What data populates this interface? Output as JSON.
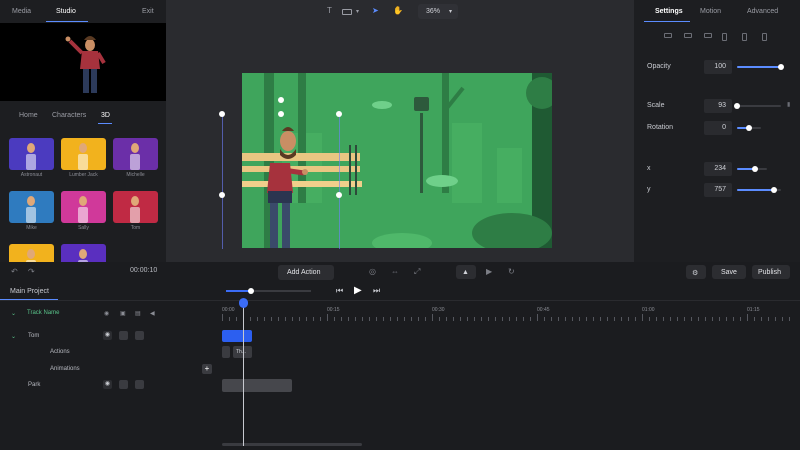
{
  "left_panel": {
    "tabs": [
      "Media",
      "Studio",
      "Exit"
    ],
    "active_tab": "Studio",
    "categories": [
      "Home",
      "Characters",
      "3D"
    ],
    "active_category": "3D",
    "characters": [
      {
        "name": "Astronaut",
        "bg": "#4b3bbf"
      },
      {
        "name": "Lumber Jack",
        "bg": "#f2b21d"
      },
      {
        "name": "Michelle",
        "bg": "#6b2fa8"
      },
      {
        "name": "Mike",
        "bg": "#2f7bbf"
      },
      {
        "name": "Sally",
        "bg": "#d0399a"
      },
      {
        "name": "Tom",
        "bg": "#c02a44"
      },
      {
        "name": "",
        "bg": "#f2b21d"
      },
      {
        "name": "",
        "bg": "#5a2fbf"
      }
    ]
  },
  "toolbar": {
    "text_tool": "T",
    "zoom": "36%",
    "icons": [
      "text-tool-icon",
      "shape-tool-icon",
      "pointer-tool-icon",
      "hand-tool-icon",
      "zoom-dropdown-icon"
    ]
  },
  "right_panel": {
    "tabs": [
      "Settings",
      "Motion",
      "Advanced"
    ],
    "active_tab": "Settings",
    "opacity": {
      "label": "Opacity",
      "value": "100",
      "unit": "%",
      "level": 1.0
    },
    "scale": {
      "label": "Scale",
      "value": "93",
      "level": 0.0
    },
    "rotation": {
      "label": "Rotation",
      "value": "0",
      "unit": "°",
      "level": 0.5
    },
    "x": {
      "label": "x",
      "value": "234",
      "level": 0.6
    },
    "y": {
      "label": "y",
      "value": "757",
      "level": 0.85
    }
  },
  "midbar": {
    "time": "00:00:10",
    "add_action": "Add Action",
    "save": "Save",
    "publish": "Publish"
  },
  "timeline": {
    "project_tab": "Main Project",
    "track_name_header": "Track Name",
    "tracks": [
      "Tom",
      "Actions",
      "Animations",
      "Park"
    ],
    "ruler_labels": [
      "00:00",
      "00:15",
      "00:30",
      "00:45",
      "01:00",
      "01:15"
    ],
    "action_clip_label": "Th..."
  },
  "colors": {
    "accent": "#5b8cff",
    "clip_blue": "#2c5ff0",
    "scene_green": "#3fa55c"
  }
}
